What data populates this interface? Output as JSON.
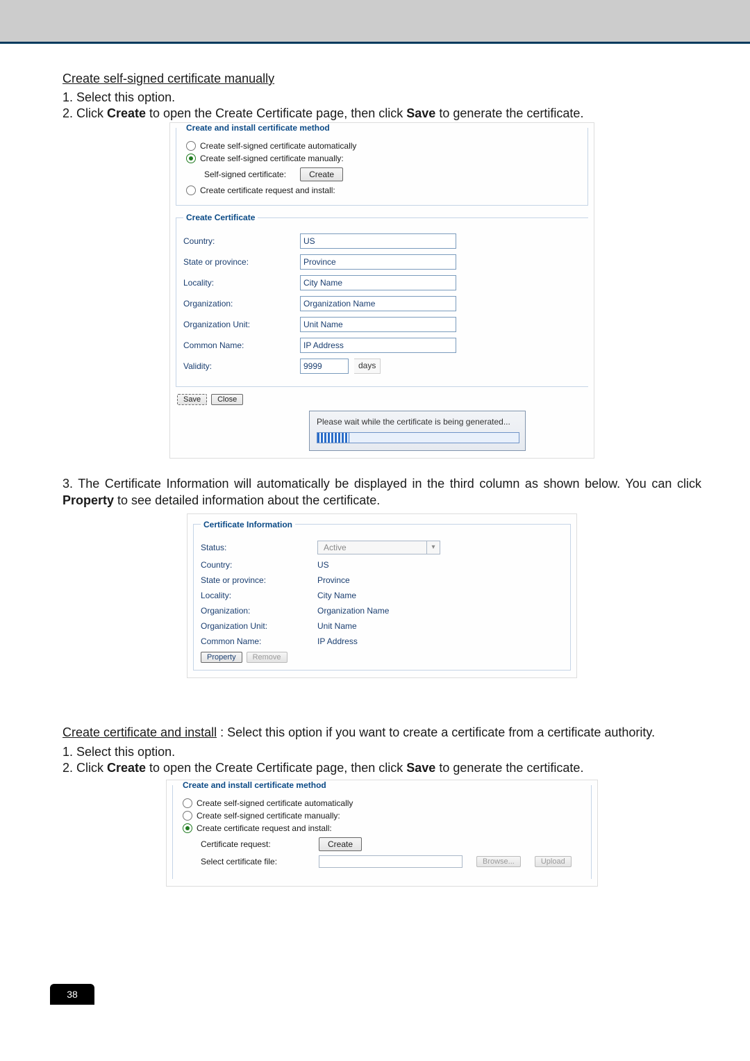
{
  "page_number": "38",
  "section1": {
    "title": "Create self-signed certificate manually",
    "step1": "1. Select this option.",
    "step2_pre": "2. Click ",
    "step2_b1": "Create",
    "step2_mid": " to open the Create Certificate page, then click ",
    "step2_b2": "Save",
    "step2_post": " to generate the certificate."
  },
  "fig1": {
    "legend": "Create and install certificate method",
    "radio_auto": "Create self-signed certificate automatically",
    "radio_manual": "Create self-signed certificate manually:",
    "self_label": "Self-signed certificate:",
    "create_btn": "Create",
    "radio_req": "Create certificate request and install:",
    "create_cert_legend": "Create Certificate",
    "rows": {
      "country_l": "Country:",
      "country_v": "US",
      "state_l": "State or province:",
      "state_v": "Province",
      "locality_l": "Locality:",
      "locality_v": "City Name",
      "org_l": "Organization:",
      "org_v": "Organization Name",
      "unit_l": "Organization Unit:",
      "unit_v": "Unit Name",
      "common_l": "Common Name:",
      "common_v": "IP Address",
      "validity_l": "Validity:",
      "validity_v": "9999",
      "validity_unit": "days"
    },
    "save_btn": "Save",
    "close_btn": "Close",
    "progress_text": "Please wait while the certificate is being generated..."
  },
  "para3": {
    "pre": "3. The Certificate Information will automatically be displayed in the third column as shown below. You can click ",
    "bold": "Property",
    "post": " to see detailed information about the certificate."
  },
  "figInfo": {
    "legend": "Certificate Information",
    "status_l": "Status:",
    "status_v": "Active",
    "country_l": "Country:",
    "country_v": "US",
    "state_l": "State or province:",
    "state_v": "Province",
    "locality_l": "Locality:",
    "locality_v": "City Name",
    "org_l": "Organization:",
    "org_v": "Organization Name",
    "unit_l": "Organization Unit:",
    "unit_v": "Unit Name",
    "common_l": "Common Name:",
    "common_v": "IP Address",
    "property_btn": "Property",
    "remove_btn": "Remove"
  },
  "section2": {
    "title": "Create certificate and install",
    "intro_post": " : Select this option if you want to create a certificate from a certificate authority.",
    "step1": "1. Select this option.",
    "step2_pre": "2. Click ",
    "step2_b1": "Create",
    "step2_mid": " to open the Create Certificate page, then click ",
    "step2_b2": "Save",
    "step2_post": " to generate the certificate."
  },
  "fig3": {
    "legend": "Create and install certificate method",
    "radio_auto": "Create self-signed certificate automatically",
    "radio_manual": "Create self-signed certificate manually:",
    "radio_req": "Create certificate request and install:",
    "cert_req_l": "Certificate request:",
    "create_btn": "Create",
    "selectfile_l": "Select certificate file:",
    "browse_btn": "Browse...",
    "upload_btn": "Upload"
  }
}
